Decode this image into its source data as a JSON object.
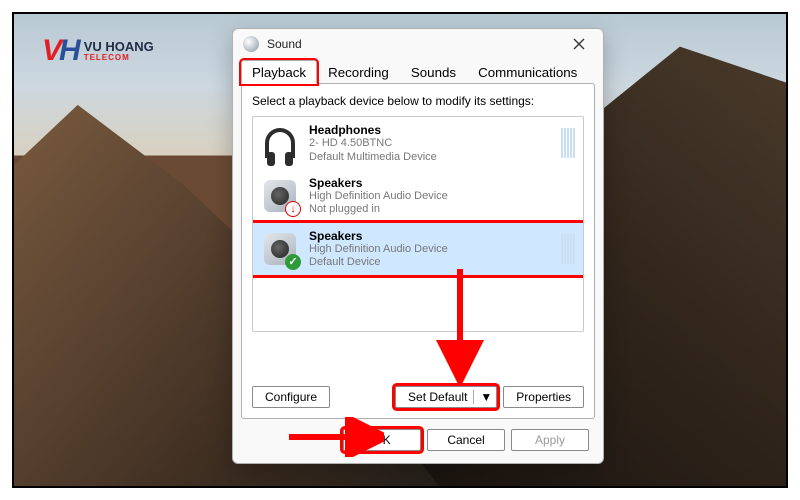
{
  "logo": {
    "brand": "VU HOANG",
    "sub": "TELECOM"
  },
  "dialog": {
    "title": "Sound",
    "tabs": [
      "Playback",
      "Recording",
      "Sounds",
      "Communications"
    ],
    "active_tab": "Playback",
    "instruction": "Select a playback device below to modify its settings:",
    "devices": [
      {
        "name": "Headphones",
        "line2": "2- HD 4.50BTNC",
        "line3": "Default Multimedia Device"
      },
      {
        "name": "Speakers",
        "line2": "High Definition Audio Device",
        "line3": "Not plugged in"
      },
      {
        "name": "Speakers",
        "line2": "High Definition Audio Device",
        "line3": "Default Device"
      }
    ],
    "buttons": {
      "configure": "Configure",
      "set_default": "Set Default",
      "properties": "Properties",
      "ok": "OK",
      "cancel": "Cancel",
      "apply": "Apply"
    }
  }
}
